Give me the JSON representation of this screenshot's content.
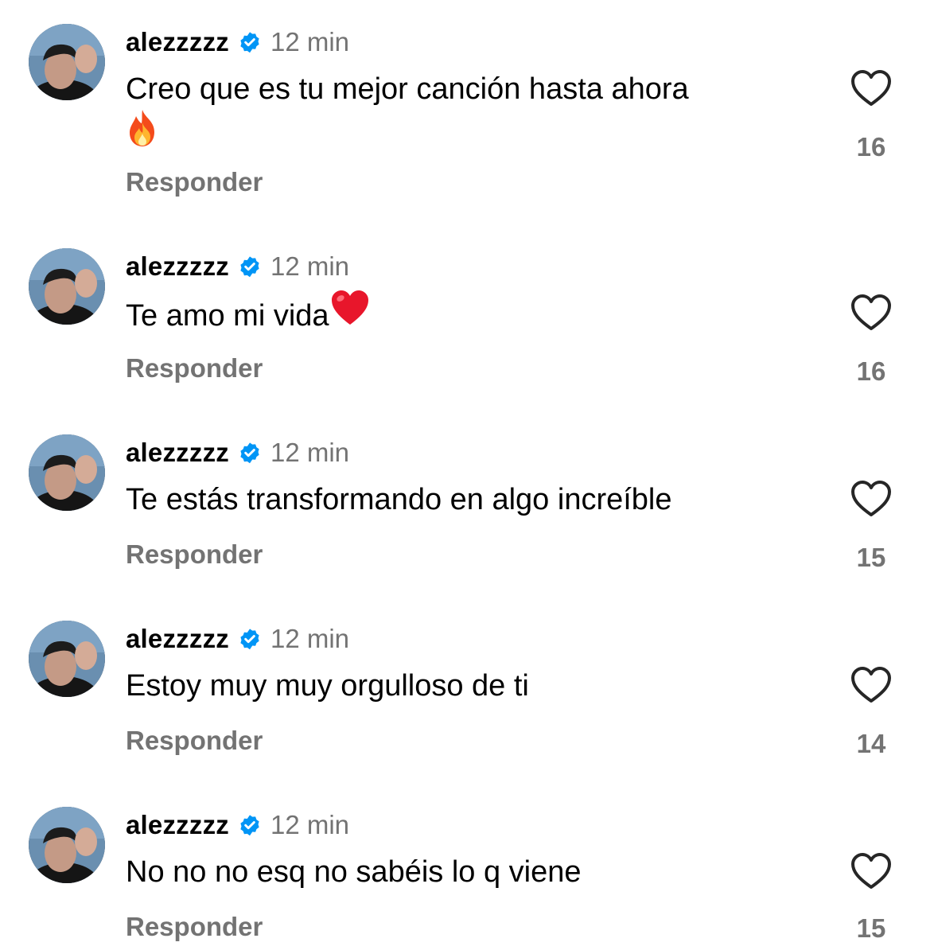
{
  "comments": [
    {
      "username": "alezzzzz",
      "time": "12 min",
      "text": "Creo que es tu mejor canción hasta ahora",
      "emoji": "fire-emoji",
      "reply_label": "Responder",
      "likes": "16"
    },
    {
      "username": "alezzzzz",
      "time": "12 min",
      "text": "Te amo mi vida",
      "emoji": "red-heart-emoji",
      "reply_label": "Responder",
      "likes": "16"
    },
    {
      "username": "alezzzzz",
      "time": "12 min",
      "text": "Te estás transformando en algo increíble",
      "reply_label": "Responder",
      "likes": "15"
    },
    {
      "username": "alezzzzz",
      "time": "12 min",
      "text": "Estoy muy muy orgulloso de ti",
      "reply_label": "Responder",
      "likes": "14"
    },
    {
      "username": "alezzzzz",
      "time": "12 min",
      "text": "No no no esq no sabéis lo q viene",
      "reply_label": "Responder",
      "likes": "15"
    }
  ],
  "icons": {
    "verified": "verified-badge-icon",
    "like": "heart-outline-icon"
  },
  "colors": {
    "verified_blue": "#0095f6",
    "secondary_text": "#737373"
  }
}
